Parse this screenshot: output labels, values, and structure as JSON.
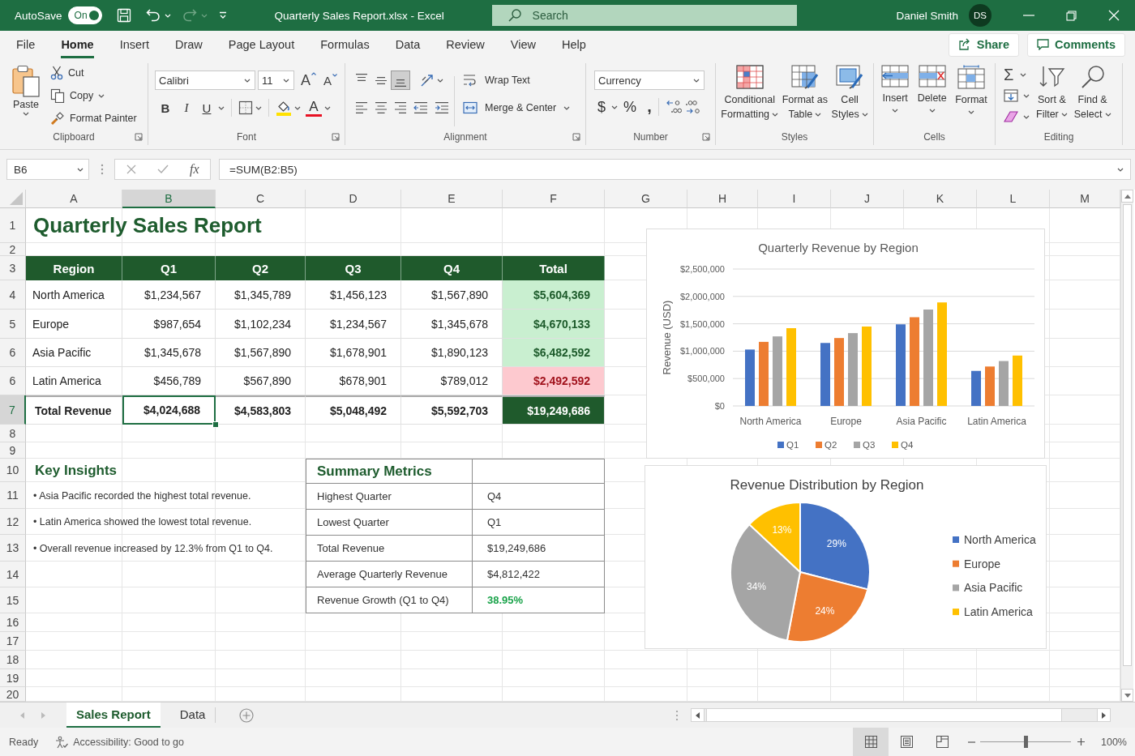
{
  "title_bar": {
    "autosave": {
      "label": "AutoSave",
      "on": true,
      "state_text": "On"
    },
    "document_title": "Quarterly Sales Report.xlsx - Excel",
    "search": {
      "placeholder": "Search"
    },
    "user": {
      "name": "Daniel Smith",
      "initials": "DS"
    }
  },
  "menu_tabs": [
    {
      "label": "File",
      "selected": false
    },
    {
      "label": "Home",
      "selected": true
    },
    {
      "label": "Insert",
      "selected": false
    },
    {
      "label": "Draw",
      "selected": false
    },
    {
      "label": "Page Layout",
      "selected": false
    },
    {
      "label": "Formulas",
      "selected": false
    },
    {
      "label": "Data",
      "selected": false
    },
    {
      "label": "Review",
      "selected": false
    },
    {
      "label": "View",
      "selected": false
    },
    {
      "label": "Help",
      "selected": false
    }
  ],
  "share_button": "Share",
  "comments_button": "Comments",
  "ribbon": {
    "clipboard": {
      "label": "Clipboard",
      "paste": "Paste",
      "cut": "Cut",
      "copy": "Copy",
      "format_painter": "Format Painter"
    },
    "font": {
      "label": "Font",
      "font_name": "Calibri",
      "font_size": "11",
      "grow_font": "A",
      "shrink_font": "A",
      "bold": "B",
      "italic": "I",
      "underline": "U",
      "font_color": "A"
    },
    "alignment": {
      "label": "Alignment",
      "vertical": [
        {
          "kind": "top",
          "selected": false
        },
        {
          "kind": "middle",
          "selected": false
        },
        {
          "kind": "bottom",
          "selected": true
        }
      ],
      "wrap_text": "Wrap Text",
      "merge_center": "Merge & Center"
    },
    "number": {
      "label": "Number",
      "format": "Currency",
      "currency": "$",
      "percent": "%",
      "comma": ","
    },
    "styles": {
      "label": "Styles",
      "buttons": [
        {
          "kind": "conditional",
          "label": "Conditional\nFormatting"
        },
        {
          "kind": "table",
          "label": "Format as\nTable"
        },
        {
          "kind": "cell_styles",
          "label": "Cell\nStyles"
        }
      ]
    },
    "cells": {
      "label": "Cells",
      "buttons": [
        {
          "kind": "insert",
          "label": "Insert"
        },
        {
          "kind": "delete",
          "label": "Delete"
        },
        {
          "kind": "format",
          "label": "Format"
        }
      ]
    },
    "editing": {
      "label": "Editing",
      "autosum": "Σ",
      "buttons": [
        {
          "kind": "sort",
          "label": "Sort &\nFilter"
        },
        {
          "kind": "find",
          "label": "Find &\nSelect"
        }
      ]
    }
  },
  "formula_bar": {
    "name_box": "B6",
    "function_label": "fx",
    "formula": "=SUM(B2:B5)"
  },
  "sheet": {
    "columns": [
      {
        "label": "A",
        "selected": false
      },
      {
        "label": "B",
        "selected": true
      },
      {
        "label": "C",
        "selected": false
      },
      {
        "label": "D",
        "selected": false
      },
      {
        "label": "E",
        "selected": false
      },
      {
        "label": "F",
        "selected": false
      },
      {
        "label": "G",
        "selected": false
      },
      {
        "label": "H",
        "selected": false
      },
      {
        "label": "I",
        "selected": false
      },
      {
        "label": "J",
        "selected": false
      },
      {
        "label": "K",
        "selected": false
      },
      {
        "label": "L",
        "selected": false
      },
      {
        "label": "M",
        "selected": false
      }
    ],
    "rows": [
      {
        "label": "1",
        "selected": false
      },
      {
        "label": "2",
        "selected": false
      },
      {
        "label": "3",
        "selected": false
      },
      {
        "label": "4",
        "selected": false
      },
      {
        "label": "5",
        "selected": false
      },
      {
        "label": "6",
        "selected": false
      },
      {
        "label": "6",
        "selected": false
      },
      {
        "label": "7",
        "selected": true
      },
      {
        "label": "8",
        "selected": false
      },
      {
        "label": "9",
        "selected": false
      },
      {
        "label": "10",
        "selected": false
      },
      {
        "label": "11",
        "selected": false
      },
      {
        "label": "12",
        "selected": false
      },
      {
        "label": "13",
        "selected": false
      },
      {
        "label": "14",
        "selected": false
      },
      {
        "label": "15",
        "selected": false
      },
      {
        "label": "16",
        "selected": false
      },
      {
        "label": "17",
        "selected": false
      },
      {
        "label": "18",
        "selected": false
      },
      {
        "label": "19",
        "selected": false
      },
      {
        "label": "20",
        "selected": false
      }
    ],
    "title": "Quarterly Sales Report",
    "sales_table": {
      "columns": [
        "Region",
        "Q1",
        "Q2",
        "Q3",
        "Q4",
        "Total"
      ],
      "rows": [
        {
          "region": "North America",
          "values": [
            "$1,234,567",
            "$1,345,789",
            "$1,456,123",
            "$1,567,890"
          ],
          "total": "$5,604,369",
          "low": false
        },
        {
          "region": "Europe",
          "values": [
            "$987,654",
            "$1,102,234",
            "$1,234,567",
            "$1,345,678"
          ],
          "total": "$4,670,133",
          "low": false
        },
        {
          "region": "Asia Pacific",
          "values": [
            "$1,345,678",
            "$1,567,890",
            "$1,678,901",
            "$1,890,123"
          ],
          "total": "$6,482,592",
          "low": false
        },
        {
          "region": "Latin America",
          "values": [
            "$456,789",
            "$567,890",
            "$678,901",
            "$789,012"
          ],
          "total": "$2,492,592",
          "low": true
        }
      ],
      "total_row": {
        "label": "Total Revenue",
        "values": [
          {
            "text": "$4,024,688",
            "selected": true
          },
          {
            "text": "$4,583,803",
            "selected": false
          },
          {
            "text": "$5,048,492",
            "selected": false
          },
          {
            "text": "$5,592,703",
            "selected": false
          }
        ],
        "total": "$19,249,686"
      }
    },
    "key_insights": {
      "title": "Key Insights",
      "items": [
        "• Asia Pacific recorded the highest total revenue.",
        "• Latin America showed the lowest total revenue.",
        "• Overall revenue increased by 12.3% from Q1 to Q4."
      ]
    },
    "summary_metrics": {
      "title": "Summary Metrics",
      "rows": [
        {
          "label": "Highest Quarter",
          "value": "Q4",
          "positive": false
        },
        {
          "label": "Lowest Quarter",
          "value": "Q1",
          "positive": false
        },
        {
          "label": "Total Revenue",
          "value": "$19,249,686",
          "positive": false
        },
        {
          "label": "Average Quarterly Revenue",
          "value": "$4,812,422",
          "positive": false
        },
        {
          "label": "Revenue Growth (Q1 to Q4)",
          "value": "38.95%",
          "positive": true
        }
      ]
    },
    "bar_chart": {
      "chart_data": {
        "type": "bar",
        "title": "Quarterly Revenue by Region",
        "ylabel": "Revenue (USD)",
        "categories": [
          "North America",
          "Europe",
          "Asia Pacific",
          "Latin America"
        ],
        "series": [
          {
            "name": "Q1",
            "color": "#4472c4",
            "values": [
              1030000,
              1150000,
              1490000,
              640000
            ]
          },
          {
            "name": "Q2",
            "color": "#ed7d31",
            "values": [
              1170000,
              1240000,
              1620000,
              720000
            ]
          },
          {
            "name": "Q3",
            "color": "#a5a5a5",
            "values": [
              1270000,
              1330000,
              1760000,
              820000
            ]
          },
          {
            "name": "Q4",
            "color": "#ffc000",
            "values": [
              1420000,
              1450000,
              1890000,
              920000
            ]
          }
        ],
        "ylim": [
          0,
          2500000
        ],
        "yticks": [
          {
            "value": 0,
            "label": "$0"
          },
          {
            "value": 500000,
            "label": "$500,000"
          },
          {
            "value": 1000000,
            "label": "$1,000,000"
          },
          {
            "value": 1500000,
            "label": "$1,500,000"
          },
          {
            "value": 2000000,
            "label": "$2,000,000"
          },
          {
            "value": 2500000,
            "label": "$2,500,000"
          }
        ],
        "grid": true,
        "legend": "bottom"
      }
    },
    "pie_chart": {
      "chart_data": {
        "type": "pie",
        "title": "Revenue Distribution by Region",
        "categories": [
          "North America",
          "Europe",
          "Asia Pacific",
          "Latin America"
        ],
        "values": [
          29,
          24,
          34,
          13
        ],
        "colors": [
          "#4472c4",
          "#ed7d31",
          "#a5a5a5",
          "#ffc000"
        ],
        "value_labels": [
          "29%",
          "24%",
          "34%",
          "13%"
        ],
        "legend": "right"
      }
    }
  },
  "sheet_tabs": [
    {
      "label": "Sales Report",
      "selected": true
    },
    {
      "label": "Data",
      "selected": false
    }
  ],
  "status_bar": {
    "status": "Ready",
    "accessibility": "Accessibility: Good to go",
    "views": [
      {
        "kind": "normal",
        "selected": true
      },
      {
        "kind": "page_layout",
        "selected": false
      },
      {
        "kind": "page_break",
        "selected": false
      }
    ],
    "zoom": {
      "level": 0.5,
      "reading": "100%"
    }
  }
}
